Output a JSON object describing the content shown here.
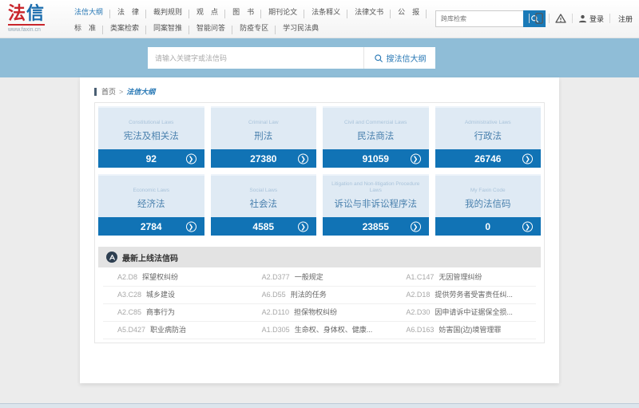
{
  "brand": {
    "logo_main_1": "法",
    "logo_main_2": "信",
    "logo_sub": "www.faxin.cn"
  },
  "topnav": {
    "row1": [
      "法信大纲",
      "法　律",
      "裁判规则",
      "观　点",
      "图　书",
      "期刊论文",
      "法条释义",
      "法律文书",
      "公　报"
    ],
    "row2": [
      "标　准",
      "类案检索",
      "同案智推",
      "智能问答",
      "防疫专区",
      "学习民法典"
    ]
  },
  "quick_search": {
    "placeholder": "跨库检索"
  },
  "user_actions": {
    "login": "登录",
    "register": "注册"
  },
  "main_search": {
    "placeholder": "请输入关键字或法信码",
    "button": "搜法信大纲"
  },
  "breadcrumb": {
    "home": "首页",
    "separator": ">",
    "current": "法信大纲"
  },
  "cards": [
    {
      "en": "Constitutional Laws",
      "zh": "宪法及相关法",
      "count": "92"
    },
    {
      "en": "Criminal Law",
      "zh": "刑法",
      "count": "27380"
    },
    {
      "en": "Civil and Commercial Laws",
      "zh": "民法商法",
      "count": "91059"
    },
    {
      "en": "Administrative Laws",
      "zh": "行政法",
      "count": "26746"
    },
    {
      "en": "Economic Laws",
      "zh": "经济法",
      "count": "2784"
    },
    {
      "en": "Social Laws",
      "zh": "社会法",
      "count": "4585"
    },
    {
      "en": "Litigation and Non-litigation Procedure Laws",
      "zh": "诉讼与非诉讼程序法",
      "count": "23855"
    },
    {
      "en": "My Faxin Code",
      "zh": "我的法信码",
      "count": "0"
    }
  ],
  "latest": {
    "title": "最新上线法信码",
    "items": [
      {
        "code": "A2.D8",
        "title": "探望权纠纷"
      },
      {
        "code": "A2.D377",
        "title": "一般规定"
      },
      {
        "code": "A1.C147",
        "title": "无因管理纠纷"
      },
      {
        "code": "A3.C28",
        "title": "城乡建设"
      },
      {
        "code": "A6.D55",
        "title": "刑法的任务"
      },
      {
        "code": "A2.D18",
        "title": "提供劳务者受害责任纠..."
      },
      {
        "code": "A2.C85",
        "title": "商事行为"
      },
      {
        "code": "A2.D110",
        "title": "担保物权纠纷"
      },
      {
        "code": "A2.D30",
        "title": "因申请诉中证据保全损..."
      },
      {
        "code": "A5.D427",
        "title": "职业病防治"
      },
      {
        "code": "A1.D305",
        "title": "生命权、身体权、健康..."
      },
      {
        "code": "A6.D163",
        "title": "妨害国(边)境管理罪"
      }
    ]
  },
  "colors": {
    "accent_blue": "#1173b5",
    "band_blue": "#8fbdd7",
    "card_body_blue": "#dfeaf4",
    "link_blue": "#2878b5",
    "logo_red": "#c9252c",
    "logo_blue": "#1a6cad",
    "section_gray": "#e3e3e3"
  }
}
